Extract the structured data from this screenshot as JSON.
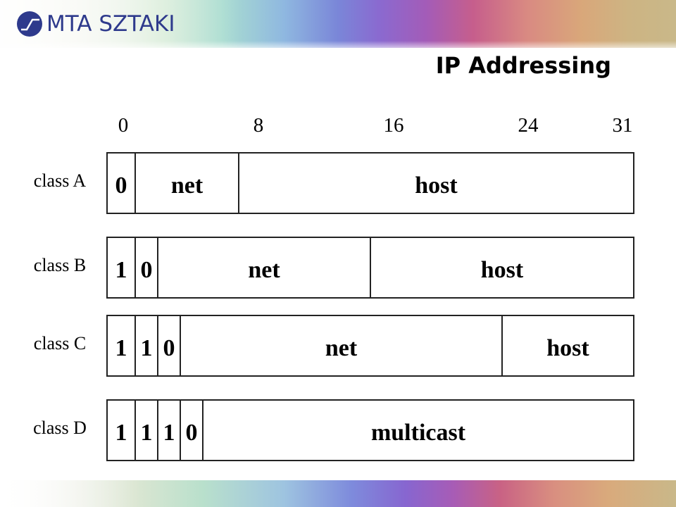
{
  "header": {
    "logo_text": "MTA SZTAKI",
    "logo_icon": "sztaki-logo-icon",
    "title": "IP Addressing"
  },
  "colors": {
    "logo_blue": "#2e3a8c",
    "text": "#000000",
    "border": "#222222"
  },
  "bit_positions": [
    "0",
    "8",
    "16",
    "24",
    "31"
  ],
  "address_classes": [
    {
      "label": "class A",
      "fields": [
        {
          "text": "0",
          "bits": 1,
          "kind": "prefix"
        },
        {
          "text": "net",
          "bits": 7,
          "kind": "net"
        },
        {
          "text": "host",
          "bits": 24,
          "kind": "host"
        }
      ]
    },
    {
      "label": "class B",
      "fields": [
        {
          "text": "1",
          "bits": 1,
          "kind": "prefix"
        },
        {
          "text": "0",
          "bits": 1,
          "kind": "prefix"
        },
        {
          "text": "net",
          "bits": 14,
          "kind": "net"
        },
        {
          "text": "host",
          "bits": 16,
          "kind": "host"
        }
      ]
    },
    {
      "label": "class C",
      "fields": [
        {
          "text": "1",
          "bits": 1,
          "kind": "prefix"
        },
        {
          "text": "1",
          "bits": 1,
          "kind": "prefix"
        },
        {
          "text": "0",
          "bits": 1,
          "kind": "prefix"
        },
        {
          "text": "net",
          "bits": 21,
          "kind": "net"
        },
        {
          "text": "host",
          "bits": 8,
          "kind": "host"
        }
      ]
    },
    {
      "label": "class D",
      "fields": [
        {
          "text": "1",
          "bits": 1,
          "kind": "prefix"
        },
        {
          "text": "1",
          "bits": 1,
          "kind": "prefix"
        },
        {
          "text": "1",
          "bits": 1,
          "kind": "prefix"
        },
        {
          "text": "0",
          "bits": 1,
          "kind": "prefix"
        },
        {
          "text": "multicast",
          "bits": 28,
          "kind": "multicast"
        }
      ]
    }
  ]
}
